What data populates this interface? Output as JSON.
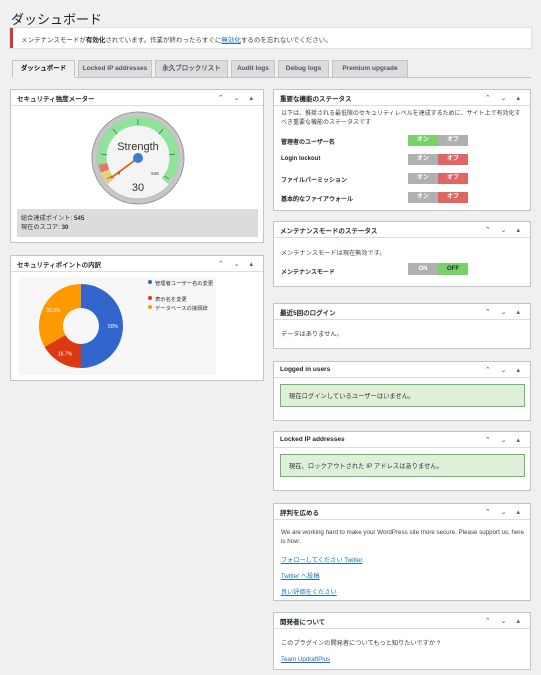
{
  "page": {
    "title": "ダッシュボード"
  },
  "notice": {
    "prefix": "メンテナンスモードが",
    "bold": "有効化",
    "mid": "されています。作業が終わったらすぐに",
    "link": "無効化",
    "suffix": "するのを忘れないでください。"
  },
  "tabs": [
    "ダッシュボード",
    "Locked IP addresses",
    "永久ブロックリスト",
    "Audit logs",
    "Debug logs",
    "Premium upgrade"
  ],
  "meter": {
    "title": "セキュリティ強度メーター",
    "label": "Strength",
    "score": "30",
    "min": "0",
    "max": "545",
    "total_label": "総合達成ポイント: ",
    "total": "545",
    "score_label": "現在のスコア: ",
    "score_val": "30",
    "score_fraction": 0.055
  },
  "breakdown": {
    "title": "セキュリティポイントの内訳",
    "chart_data": {
      "type": "pie",
      "categories": [
        "管理者ユーザー名の変更",
        "表示名を変更",
        "データベースの接頭辞"
      ],
      "values": [
        50,
        16.7,
        33.3
      ],
      "labels": [
        "50%",
        "16.7%",
        "33.3%"
      ],
      "colors": [
        "#3366cc",
        "#dc3912",
        "#ff9900"
      ]
    }
  },
  "critical": {
    "title": "重要な機能のステータス",
    "desc": "以下は、推奨される最低限のセキュリティレベルを達成するために、サイト上で有効化すべき重要な機能のステータスです",
    "items": [
      {
        "label": "管理者のユーザー名",
        "state": "on"
      },
      {
        "label": "Login lockout",
        "state": "off"
      },
      {
        "label": "ファイルパーミッション",
        "state": "off"
      },
      {
        "label": "基本的なファイアウォール",
        "state": "off"
      }
    ],
    "on": "オン",
    "off": "オフ"
  },
  "maint": {
    "title": "メンテナンスモードのステータス",
    "desc": "メンテナンスモードは現在無効です。",
    "label": "メンテナンスモード",
    "on": "ON",
    "off": "OFF"
  },
  "logins": {
    "title": "最近5回のログイン",
    "text": "データはありません。"
  },
  "logged": {
    "title": "Logged in users",
    "text": "現在ログインしているユーザーはいません。"
  },
  "locked": {
    "title": "Locked IP addresses",
    "text": "現在、ロックアウトされた IP アドレスはありません。"
  },
  "spread": {
    "title": "評判を広める",
    "text": "We are working hard to make your WordPress site more secure. Please support us, here is how:",
    "links": [
      "フォローしてください Twitter",
      "Twitter へ投稿",
      "良い評価をください"
    ]
  },
  "dev": {
    "title": "開発者について",
    "text": "このプラグインの開発者についてもっと知りたいですか ?",
    "link": "Team UpdraftPlus"
  },
  "controls": "⌃ ⌄ ▴",
  "colors": {
    "accent": "#2271b1",
    "green": "#7ad06b",
    "red": "#e06666",
    "toggle_off": "#b0b0b0"
  }
}
